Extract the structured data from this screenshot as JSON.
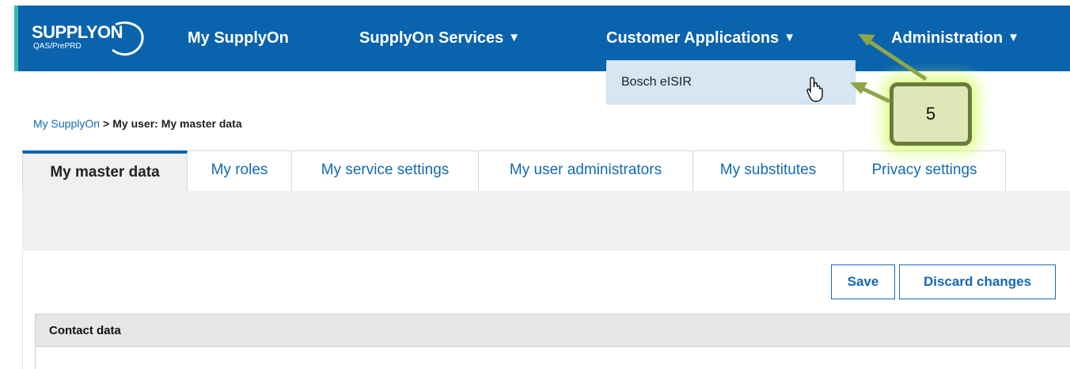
{
  "logo": {
    "brand": "SUPPLYON",
    "subtitle": "QAS/PrePRD"
  },
  "nav": {
    "items": [
      {
        "label": "My SupplyOn",
        "caret": ""
      },
      {
        "label": "SupplyOn Services",
        "caret": "▼"
      },
      {
        "label": "Customer Applications",
        "caret": "▼"
      },
      {
        "label": "Administration",
        "caret": "▼"
      }
    ],
    "dropdown": {
      "option": "Bosch eISIR"
    }
  },
  "breadcrumb": {
    "link": "My SupplyOn",
    "separator": ">",
    "current": "My user: My master data"
  },
  "tabs": [
    {
      "label": "My master data",
      "active": true
    },
    {
      "label": "My roles"
    },
    {
      "label": "My service settings"
    },
    {
      "label": "My user administrators"
    },
    {
      "label": "My substitutes"
    },
    {
      "label": "Privacy settings"
    }
  ],
  "actions": {
    "save": "Save",
    "discard": "Discard changes"
  },
  "section": {
    "title": "Contact data"
  },
  "annotation": {
    "step": "5"
  },
  "colors": {
    "nav_bg": "#0a63ad",
    "accent_edge": "#35b7b0",
    "link": "#1469b3",
    "callout_fill": "#dfe6b8",
    "callout_border": "#6b7a3d"
  },
  "icons": {
    "cursor": "hand-pointer-icon",
    "caret": "triangle-down-icon"
  }
}
